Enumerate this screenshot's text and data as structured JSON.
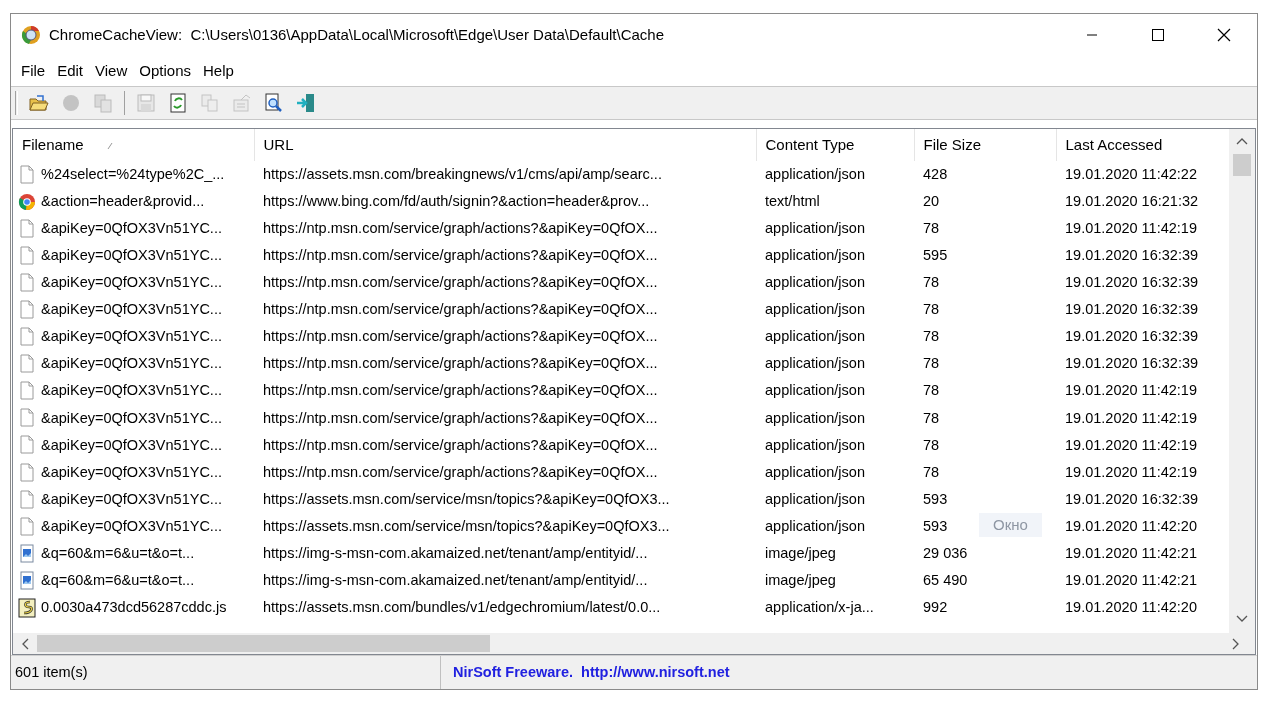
{
  "window": {
    "title": "ChromeCacheView:  C:\\Users\\0136\\AppData\\Local\\Microsoft\\Edge\\User Data\\Default\\Cache"
  },
  "menu": [
    "File",
    "Edit",
    "View",
    "Options",
    "Help"
  ],
  "toolbar": [
    {
      "kind": "open",
      "disabled": false
    },
    {
      "kind": "stop",
      "disabled": true
    },
    {
      "kind": "copy-files",
      "disabled": true
    },
    {
      "kind": "separator"
    },
    {
      "kind": "save",
      "disabled": true
    },
    {
      "kind": "refresh",
      "disabled": false
    },
    {
      "kind": "copy",
      "disabled": true
    },
    {
      "kind": "properties",
      "disabled": true
    },
    {
      "kind": "find",
      "disabled": false
    },
    {
      "kind": "exit",
      "disabled": false
    }
  ],
  "table": {
    "columns": [
      {
        "label": "Filename",
        "sorted": true
      },
      {
        "label": "URL",
        "sorted": false
      },
      {
        "label": "Content Type",
        "sorted": false
      },
      {
        "label": "File Size",
        "sorted": false
      },
      {
        "label": "Last Accessed",
        "sorted": false
      }
    ],
    "rows": [
      {
        "kind": "file",
        "filename": "%24select=%24type%2C_...",
        "url": "https://assets.msn.com/breakingnews/v1/cms/api/amp/searc...",
        "content_type": "application/json",
        "file_size": "428",
        "last_accessed": "19.01.2020 11:42:22"
      },
      {
        "kind": "chrome",
        "filename": "&action=header&provid...",
        "url": "https://www.bing.com/fd/auth/signin?&action=header&prov...",
        "content_type": "text/html",
        "file_size": "20",
        "last_accessed": "19.01.2020 16:21:32"
      },
      {
        "kind": "file",
        "filename": "&apiKey=0QfOX3Vn51YC...",
        "url": "https://ntp.msn.com/service/graph/actions?&apiKey=0QfOX...",
        "content_type": "application/json",
        "file_size": "78",
        "last_accessed": "19.01.2020 11:42:19"
      },
      {
        "kind": "file",
        "filename": "&apiKey=0QfOX3Vn51YC...",
        "url": "https://ntp.msn.com/service/graph/actions?&apiKey=0QfOX...",
        "content_type": "application/json",
        "file_size": "595",
        "last_accessed": "19.01.2020 16:32:39"
      },
      {
        "kind": "file",
        "filename": "&apiKey=0QfOX3Vn51YC...",
        "url": "https://ntp.msn.com/service/graph/actions?&apiKey=0QfOX...",
        "content_type": "application/json",
        "file_size": "78",
        "last_accessed": "19.01.2020 16:32:39"
      },
      {
        "kind": "file",
        "filename": "&apiKey=0QfOX3Vn51YC...",
        "url": "https://ntp.msn.com/service/graph/actions?&apiKey=0QfOX...",
        "content_type": "application/json",
        "file_size": "78",
        "last_accessed": "19.01.2020 16:32:39"
      },
      {
        "kind": "file",
        "filename": "&apiKey=0QfOX3Vn51YC...",
        "url": "https://ntp.msn.com/service/graph/actions?&apiKey=0QfOX...",
        "content_type": "application/json",
        "file_size": "78",
        "last_accessed": "19.01.2020 16:32:39"
      },
      {
        "kind": "file",
        "filename": "&apiKey=0QfOX3Vn51YC...",
        "url": "https://ntp.msn.com/service/graph/actions?&apiKey=0QfOX...",
        "content_type": "application/json",
        "file_size": "78",
        "last_accessed": "19.01.2020 16:32:39"
      },
      {
        "kind": "file",
        "filename": "&apiKey=0QfOX3Vn51YC...",
        "url": "https://ntp.msn.com/service/graph/actions?&apiKey=0QfOX...",
        "content_type": "application/json",
        "file_size": "78",
        "last_accessed": "19.01.2020 11:42:19"
      },
      {
        "kind": "file",
        "filename": "&apiKey=0QfOX3Vn51YC...",
        "url": "https://ntp.msn.com/service/graph/actions?&apiKey=0QfOX...",
        "content_type": "application/json",
        "file_size": "78",
        "last_accessed": "19.01.2020 11:42:19"
      },
      {
        "kind": "file",
        "filename": "&apiKey=0QfOX3Vn51YC...",
        "url": "https://ntp.msn.com/service/graph/actions?&apiKey=0QfOX...",
        "content_type": "application/json",
        "file_size": "78",
        "last_accessed": "19.01.2020 11:42:19"
      },
      {
        "kind": "file",
        "filename": "&apiKey=0QfOX3Vn51YC...",
        "url": "https://ntp.msn.com/service/graph/actions?&apiKey=0QfOX...",
        "content_type": "application/json",
        "file_size": "78",
        "last_accessed": "19.01.2020 11:42:19"
      },
      {
        "kind": "file",
        "filename": "&apiKey=0QfOX3Vn51YC...",
        "url": "https://assets.msn.com/service/msn/topics?&apiKey=0QfOX3...",
        "content_type": "application/json",
        "file_size": "593",
        "last_accessed": "19.01.2020 16:32:39"
      },
      {
        "kind": "file",
        "filename": "&apiKey=0QfOX3Vn51YC...",
        "url": "https://assets.msn.com/service/msn/topics?&apiKey=0QfOX3...",
        "content_type": "application/json",
        "file_size": "593",
        "last_accessed": "19.01.2020 11:42:20"
      },
      {
        "kind": "image",
        "filename": "&q=60&m=6&u=t&o=t...",
        "url": "https://img-s-msn-com.akamaized.net/tenant/amp/entityid/...",
        "content_type": "image/jpeg",
        "file_size": "29 036",
        "last_accessed": "19.01.2020 11:42:21"
      },
      {
        "kind": "image",
        "filename": "&q=60&m=6&u=t&o=t...",
        "url": "https://img-s-msn-com.akamaized.net/tenant/amp/entityid/...",
        "content_type": "image/jpeg",
        "file_size": "65 490",
        "last_accessed": "19.01.2020 11:42:21"
      },
      {
        "kind": "script",
        "filename": "0.0030a473dcd56287cddc.js",
        "url": "https://assets.msn.com/bundles/v1/edgechromium/latest/0.0...",
        "content_type": "application/x-ja...",
        "file_size": "992",
        "last_accessed": "19.01.2020 11:42:20"
      }
    ]
  },
  "tooltip": {
    "text": "Окно"
  },
  "status_bar": {
    "count": "601 item(s)",
    "credit": "NirSoft Freeware.",
    "link": "http://www.nirsoft.net"
  }
}
